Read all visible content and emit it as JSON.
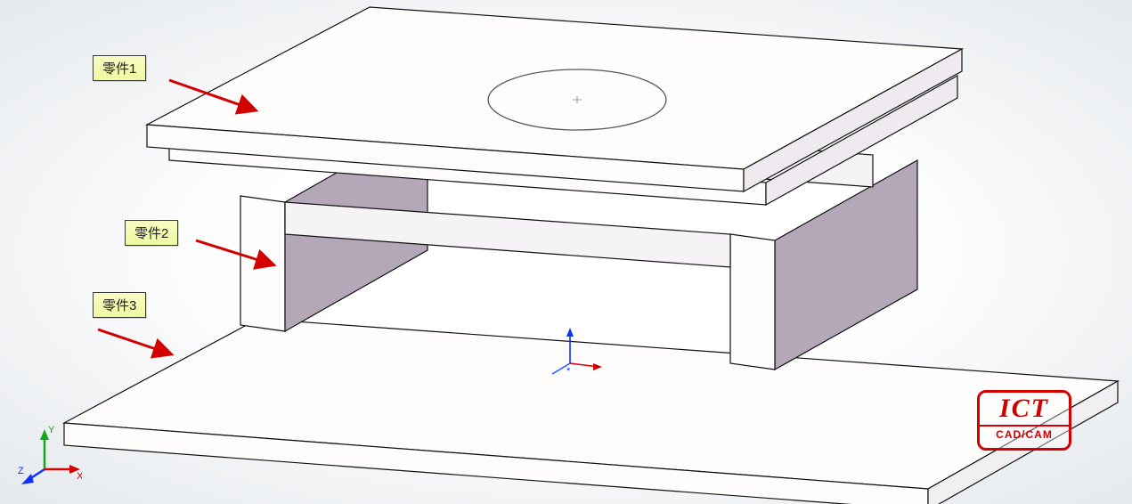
{
  "annotations": {
    "part1": "零件1",
    "part2": "零件2",
    "part3": "零件3"
  },
  "badge": {
    "title": "ICT",
    "subtitle": "CAD/CAM"
  },
  "triad": {
    "x_label": "X",
    "y_label": "Y",
    "z_label": "Z"
  }
}
